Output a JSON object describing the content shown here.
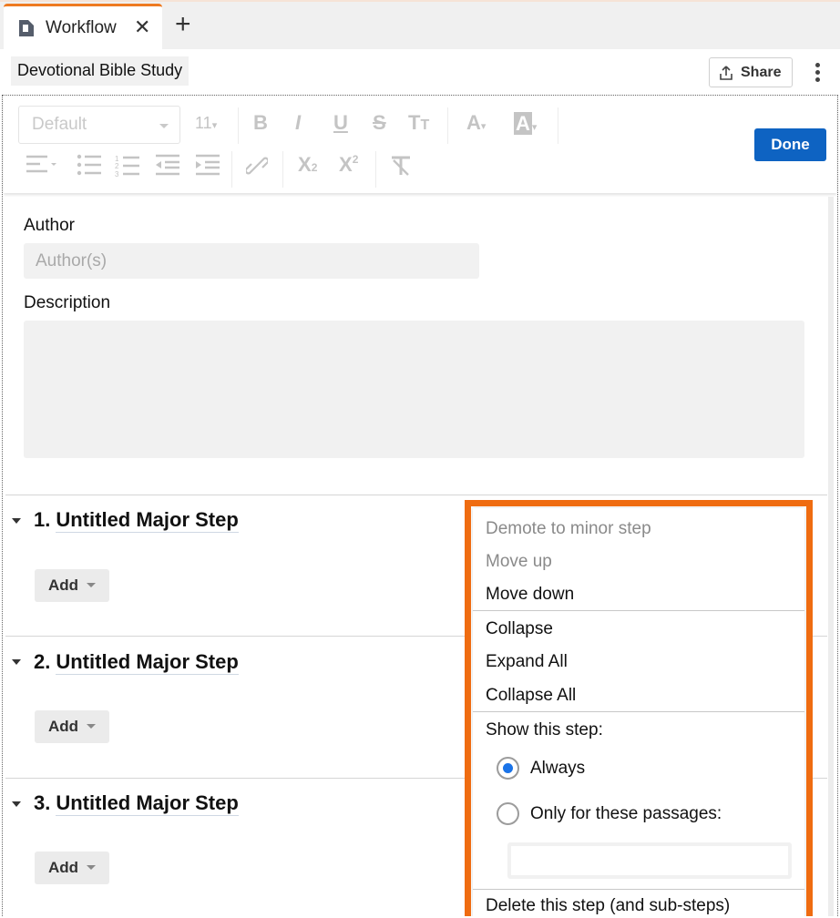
{
  "tabs": [
    {
      "label": "Workflow",
      "icon": "workflow-doc-icon",
      "close_icon": "close-icon"
    }
  ],
  "tab_add_icon": "plus-icon",
  "header": {
    "doc_title": "Devotional Bible Study",
    "share_label": "Share",
    "share_icon": "share-upload-icon",
    "more_icon": "more-vertical-icon"
  },
  "toolbar": {
    "font_family": "Default",
    "font_size": "11",
    "done_label": "Done",
    "buttons": [
      "bold",
      "italic",
      "underline",
      "strikethrough",
      "text-size",
      "font-color",
      "highlight-color",
      "align",
      "bulleted-list",
      "numbered-list",
      "outdent",
      "indent",
      "link",
      "subscript",
      "superscript",
      "clear-formatting"
    ]
  },
  "form": {
    "author_label": "Author",
    "author_placeholder": "Author(s)",
    "author_value": "",
    "description_label": "Description",
    "description_value": ""
  },
  "steps": [
    {
      "number": "1.",
      "title": "Untitled Major Step",
      "add_label": "Add"
    },
    {
      "number": "2.",
      "title": "Untitled Major Step",
      "add_label": "Add"
    },
    {
      "number": "3.",
      "title": "Untitled Major Step",
      "add_label": "Add"
    }
  ],
  "context_menu": {
    "demote": "Demote to minor step",
    "move_up": "Move up",
    "move_down": "Move down",
    "collapse": "Collapse",
    "expand_all": "Expand All",
    "collapse_all": "Collapse All",
    "show_heading": "Show this step:",
    "option_always": "Always",
    "option_passages": "Only for these passages:",
    "selected_option": "Always",
    "passages_value": "",
    "delete": "Delete this step (and sub-steps)"
  },
  "colors": {
    "accent_orange": "#ef6c11",
    "primary_blue": "#0e63c2",
    "radio_blue": "#1a73e8",
    "field_bg": "#f1f1f1"
  }
}
